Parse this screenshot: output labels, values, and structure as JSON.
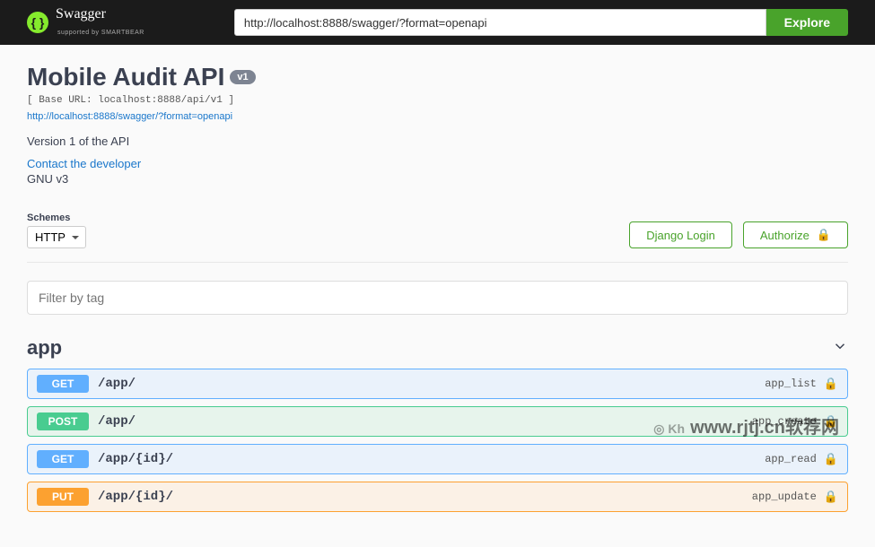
{
  "topbar": {
    "brand": "Swagger",
    "sub": "supported by SMARTBEAR",
    "url_value": "http://localhost:8888/swagger/?format=openapi",
    "explore": "Explore"
  },
  "info": {
    "title": "Mobile Audit API",
    "version": "v1",
    "base_url": "[ Base URL: localhost:8888/api/v1 ]",
    "swagger_url": "http://localhost:8888/swagger/?format=openapi",
    "description": "Version 1 of the API",
    "contact": "Contact the developer",
    "license": "GNU v3"
  },
  "schemes": {
    "label": "Schemes",
    "value": "HTTP"
  },
  "auth": {
    "django": "Django Login",
    "authorize": "Authorize"
  },
  "filter": {
    "placeholder": "Filter by tag"
  },
  "tag": {
    "name": "app"
  },
  "ops": [
    {
      "method": "GET",
      "m_class": "m-get",
      "row_class": "op-get",
      "path": "/app/",
      "op_id": "app_list"
    },
    {
      "method": "POST",
      "m_class": "m-post",
      "row_class": "op-post",
      "path": "/app/",
      "op_id": "app_create"
    },
    {
      "method": "GET",
      "m_class": "m-get",
      "row_class": "op-get",
      "path": "/app/{id}/",
      "op_id": "app_read"
    },
    {
      "method": "PUT",
      "m_class": "m-put",
      "row_class": "op-put",
      "path": "/app/{id}/",
      "op_id": "app_update"
    }
  ],
  "watermark": {
    "small": "◎ Kh",
    "main": "www.rjtj.cn软荐网"
  }
}
